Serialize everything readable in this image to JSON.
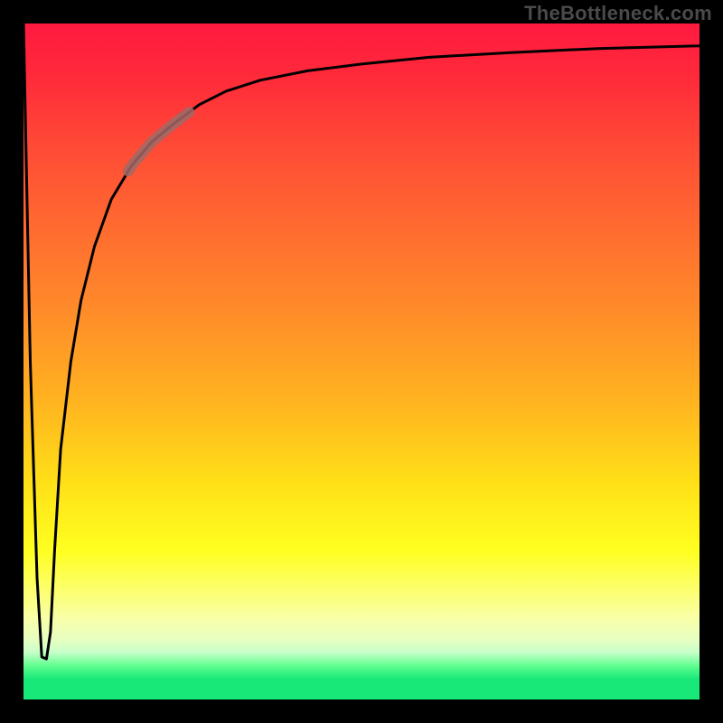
{
  "watermark": "TheBottleneck.com",
  "colors": {
    "page_bg": "#000000",
    "curve": "#000000",
    "soft_segment": "#a06a66",
    "gradient_top": "#ff1a40",
    "gradient_bottom": "#18e878"
  },
  "chart_data": {
    "type": "line",
    "title": "",
    "xlabel": "",
    "ylabel": "",
    "xlim": [
      0,
      1
    ],
    "ylim": [
      0,
      1
    ],
    "grid": false,
    "legend": false,
    "_comment": "No axis ticks or labels rendered. y-values estimated from pixel positions (1 = top, 0 = bottom of plot). Curve starts at top-left, dips to near-bottom, then rises asymptotically toward top-right.",
    "series": [
      {
        "name": "curve",
        "x": [
          0.0,
          0.01,
          0.02,
          0.027,
          0.034,
          0.04,
          0.046,
          0.055,
          0.07,
          0.085,
          0.105,
          0.13,
          0.16,
          0.19,
          0.22,
          0.26,
          0.3,
          0.35,
          0.42,
          0.5,
          0.6,
          0.72,
          0.85,
          1.0
        ],
        "y": [
          1.0,
          0.5,
          0.18,
          0.063,
          0.06,
          0.1,
          0.22,
          0.37,
          0.5,
          0.59,
          0.67,
          0.74,
          0.79,
          0.825,
          0.85,
          0.88,
          0.9,
          0.916,
          0.93,
          0.94,
          0.95,
          0.957,
          0.963,
          0.967
        ]
      }
    ],
    "soft_segment": {
      "_comment": "pale/brownish segment overlay on the curve around x≈0.16..0.24",
      "x_start": 0.155,
      "x_end": 0.245
    }
  }
}
